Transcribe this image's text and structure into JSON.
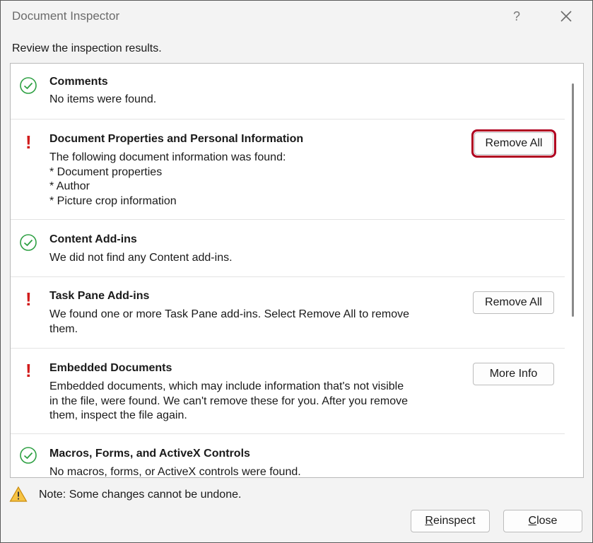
{
  "window": {
    "title": "Document Inspector",
    "help_label": "?",
    "subtitle": "Review the inspection results."
  },
  "results": [
    {
      "status": "ok",
      "heading": "Comments",
      "description": "No items were found.",
      "button": null
    },
    {
      "status": "issue",
      "heading": "Document Properties and Personal Information",
      "description": "The following document information was found:\n* Document properties\n* Author\n* Picture crop information",
      "button": "Remove All"
    },
    {
      "status": "ok",
      "heading": "Content Add-ins",
      "description": "We did not find any Content add-ins.",
      "button": null
    },
    {
      "status": "issue",
      "heading": "Task Pane Add-ins",
      "description": "We found one or more Task Pane add-ins. Select Remove All to remove\nthem.",
      "button": "Remove All"
    },
    {
      "status": "issue",
      "heading": "Embedded Documents",
      "description": "Embedded documents, which may include information that's not visible\nin the file, were found. We can't remove these for you. After you remove\nthem, inspect the file again.",
      "button": "More Info"
    },
    {
      "status": "ok",
      "heading": "Macros, Forms, and ActiveX Controls",
      "description": "No macros, forms, or ActiveX controls were found.",
      "button": null
    }
  ],
  "note": {
    "icon": "warning-icon",
    "text": "Note: Some changes cannot be undone."
  },
  "footer": {
    "reinspect_mnemonic": "R",
    "reinspect_rest": "einspect",
    "close_mnemonic": "C",
    "close_rest": "lose"
  },
  "colors": {
    "ok": "#2ea043",
    "issue": "#d11b1b",
    "highlight": "#b00020",
    "warning": "#e8a317"
  }
}
